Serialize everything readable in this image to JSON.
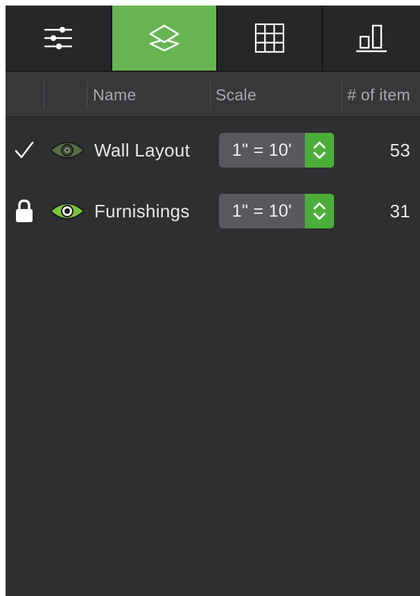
{
  "toolbar": {
    "tabs": [
      {
        "icon": "sliders-icon",
        "active": false
      },
      {
        "icon": "layers-icon",
        "active": true
      },
      {
        "icon": "grid-icon",
        "active": false
      },
      {
        "icon": "bar-chart-icon",
        "active": false
      }
    ],
    "accent_color": "#66b552"
  },
  "columns": {
    "name": "Name",
    "scale": "Scale",
    "count": "# of item"
  },
  "layers": [
    {
      "status_icon": "checkmark-icon",
      "visibility_icon": "eye-dim-icon",
      "name": "Wall Layout",
      "scale": "1\" = 10'",
      "count": "53"
    },
    {
      "status_icon": "lock-icon",
      "visibility_icon": "eye-bright-icon",
      "name": "Furnishings",
      "scale": "1\" = 10'",
      "count": "31"
    }
  ]
}
